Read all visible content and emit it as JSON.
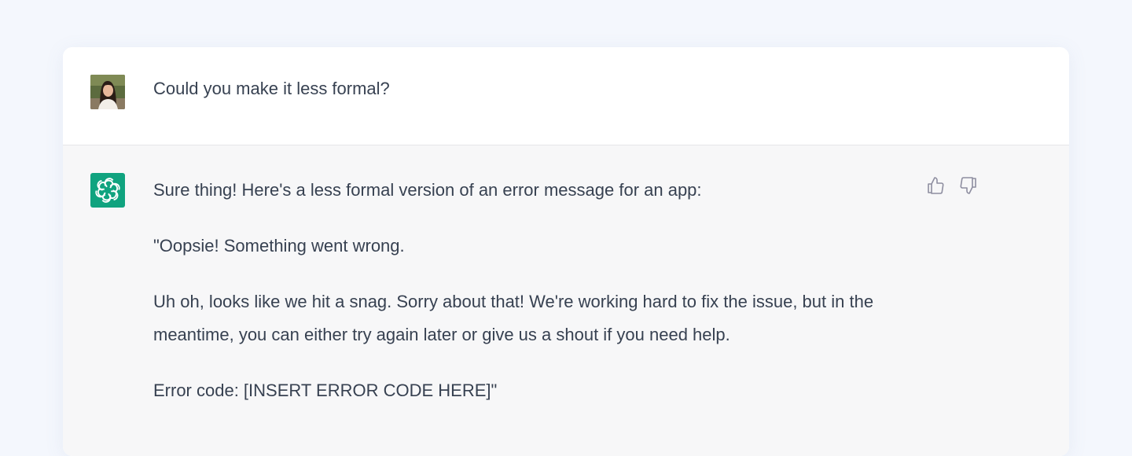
{
  "conversation": {
    "user_message": {
      "text": "Could you make it less formal?",
      "avatar_icon": "user-photo-avatar"
    },
    "assistant_message": {
      "avatar_icon": "openai-logo-icon",
      "avatar_color": "#10a37f",
      "paragraphs": [
        "Sure thing! Here's a less formal version of an error message for an app:",
        "\"Oopsie! Something went wrong.",
        "Uh oh, looks like we hit a snag. Sorry about that! We're working hard to fix the issue, but in the meantime, you can either try again later or give us a shout if you need help.",
        "Error code: [INSERT ERROR CODE HERE]\""
      ],
      "feedback": {
        "thumbs_up_icon": "thumbs-up-icon",
        "thumbs_down_icon": "thumbs-down-icon"
      }
    }
  },
  "colors": {
    "page_background": "#f4f7fd",
    "assistant_row_background": "#f7f7f8",
    "text": "#374151",
    "icon_gray": "#8e8ea0"
  }
}
